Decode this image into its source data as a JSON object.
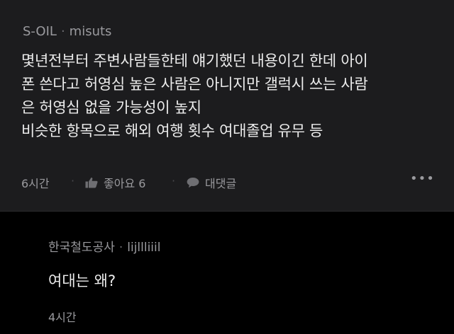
{
  "post": {
    "company": "S-OIL",
    "separator": "·",
    "username": "misuts",
    "lines": [
      "몇년전부터 주변사람들한테 얘기했던 내용이긴 한데 아이",
      "폰 쓴다고 허영심 높은 사람은 아니지만 갤럭시 쓰는 사람",
      "은 허영심 없을 가능성이 높지",
      "비슷한 항목으로 해외 여행 횟수 여대졸업 유무 등"
    ],
    "time": "6시간",
    "action_separator": "·",
    "like_label": "좋아요 6",
    "reply_label": "대댓글",
    "more_label": "•••",
    "like_icon": "thumbs-up-icon",
    "reply_icon": "speech-bubble-icon"
  },
  "comment": {
    "company": "한국철도공사",
    "separator": "·",
    "username": "lijllliiil",
    "text": "여대는 왜?",
    "time": "4시간"
  },
  "colors": {
    "post_background": "#1c1c1e",
    "comment_background": "#000000",
    "primary_text": "#ececec",
    "secondary_text": "#9a9a9e"
  }
}
